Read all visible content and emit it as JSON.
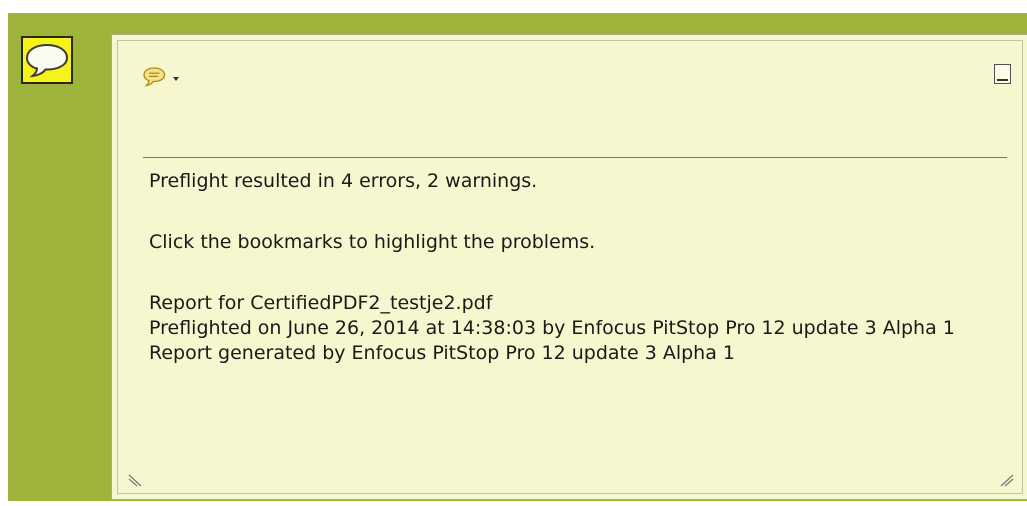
{
  "note": {
    "line1": "Preflight resulted in 4 errors, 2 warnings.",
    "line2": "Click the bookmarks to highlight the problems.",
    "line3": "Report for CertifiedPDF2_testje2.pdf",
    "line4": "Preflighted on June 26, 2014 at 14:38:03 by Enfocus PitStop Pro 12 update 3 Alpha 1",
    "line5": "Report generated by Enfocus PitStop Pro 12 update 3 Alpha 1"
  },
  "icons": {
    "annotation": "speech-bubble-icon",
    "menu": "speech-bubble-icon",
    "menu_caret": "chevron-down-icon",
    "minimize": "minimize-icon",
    "resize_left": "resize-grip-icon",
    "resize_right": "resize-grip-icon"
  },
  "colors": {
    "background": "#9db33a",
    "note_icon_fill": "#f5f21c",
    "popup_fill": "#f6f6cf"
  }
}
